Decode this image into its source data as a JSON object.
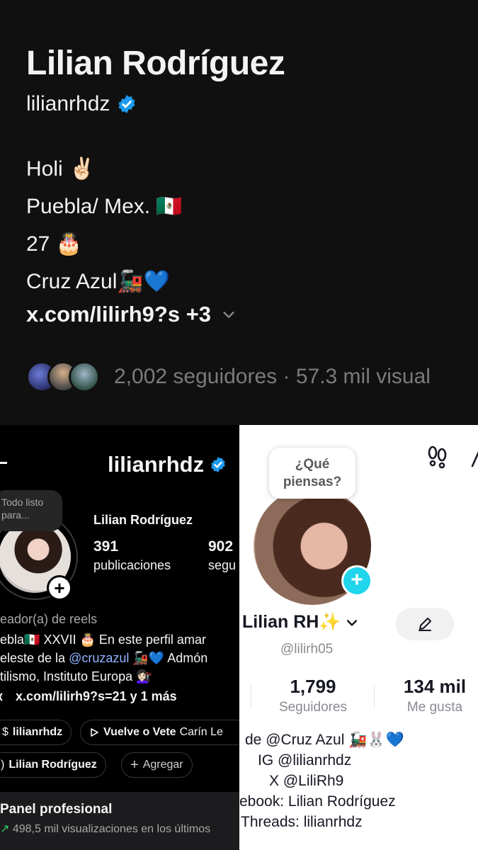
{
  "threads": {
    "name": "Lilian Rodríguez",
    "handle": "lilianrhdz",
    "bio_lines": [
      "Holi ✌🏻",
      "Puebla/ Mex. 🇲🇽",
      "27 🎂",
      "Cruz Azul🚂💙"
    ],
    "link": "x.com/lilirh9?s +3",
    "followers_text": "2,002 seguidores · 57.3 mil visual"
  },
  "instagram": {
    "username": "lilianrhdz",
    "note_bubble": "Todo listo para...",
    "full_name": "Lilian Rodríguez",
    "stats": [
      {
        "value": "391",
        "label": "publicaciones"
      },
      {
        "value": "902",
        "label": "segu"
      }
    ],
    "category": "eador(a) de reels",
    "bio_lines": [
      "ebla🇲🇽 XXVII 🎂 En este perfil amar",
      "eleste de la",
      "tilismo, Instituto Europa 💇🏻‍♀️"
    ],
    "mention": "@cruzazul",
    "bio_line2_tail": "🚂💙 Admón",
    "link": "x.com/lilirh9?s=21 y 1 más",
    "pills": {
      "threads": "lilianrhdz",
      "music_song": "Vuelve o Vete",
      "music_artist": "Carín Le",
      "facebook": "Lilian Rodríguez",
      "add": "Agregar"
    },
    "panel_title": "Panel profesional",
    "panel_subtitle": "498,5 mil visualizaciones en los últimos"
  },
  "tiktok": {
    "bubble": "¿Qué piensas?",
    "name": "Lilian RH✨",
    "handle": "@lilirh05",
    "stats": [
      {
        "value": "1,799",
        "label": "Seguidores"
      },
      {
        "value": "134 mil",
        "label": "Me gusta"
      }
    ],
    "bio_lines": [
      "de @Cruz Azul 🚂🐰💙",
      "IG @lilianrhdz",
      "X @LiliRh9",
      "ebook: Lilian Rodríguez",
      "Threads: lilianrhdz"
    ]
  },
  "colors": {
    "verified_blue": "#1d9bf0",
    "instagram_mention": "#8fb4ff",
    "tiktok_plus": "#20d5ec",
    "trend_green": "#2bd46e"
  }
}
